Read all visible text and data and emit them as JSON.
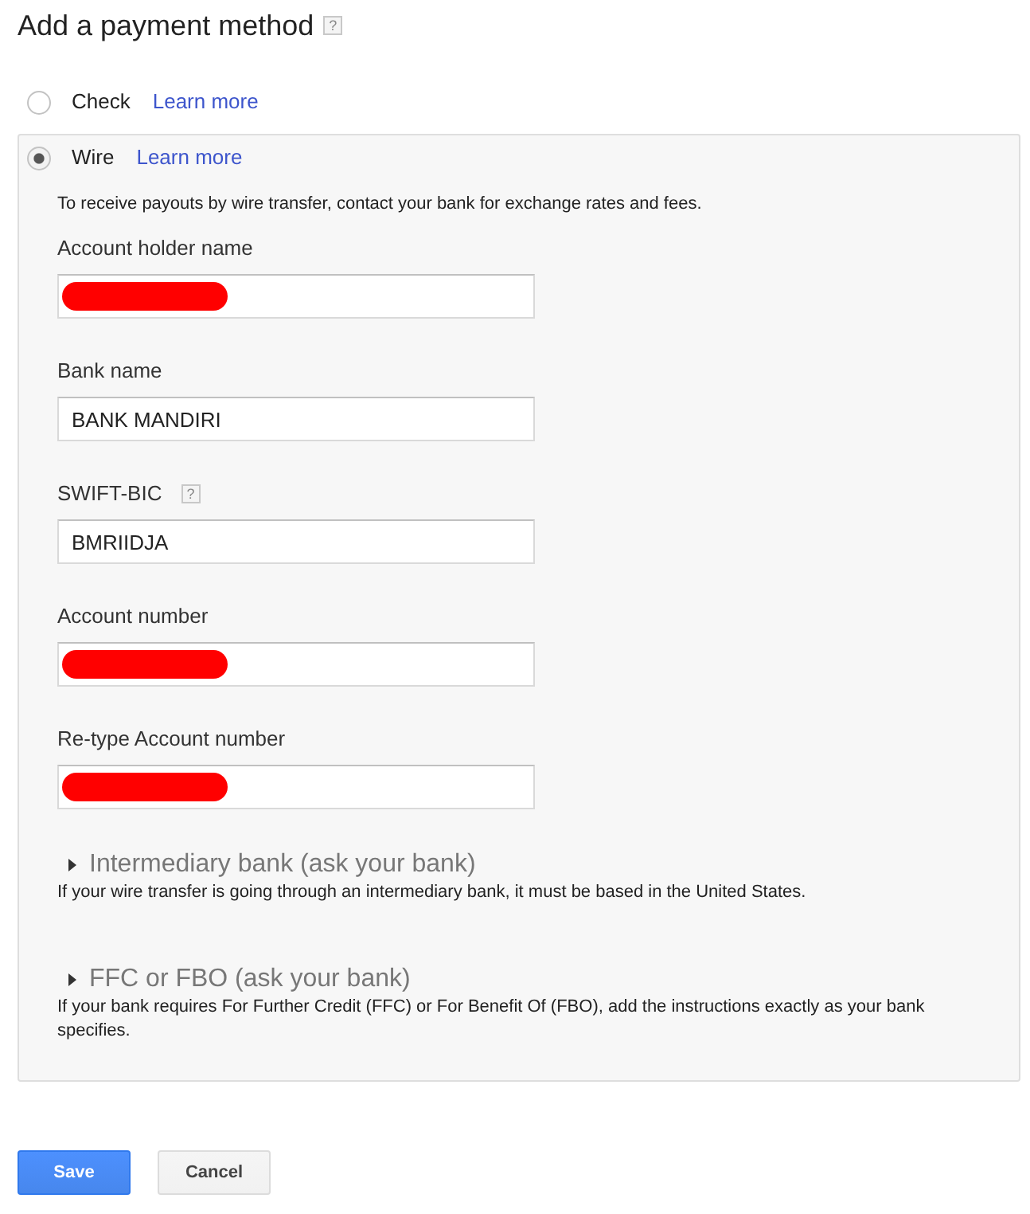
{
  "page": {
    "title": "Add a payment method",
    "help": "?"
  },
  "payment_methods": [
    {
      "label": "Check",
      "link": "Learn more",
      "selected": false
    },
    {
      "label": "Wire",
      "link": "Learn more",
      "selected": true,
      "description": "To receive payouts by wire transfer, contact your bank for exchange rates and fees.",
      "fields": [
        {
          "label": "Account holder name",
          "redacted": true
        },
        {
          "label": "Bank name",
          "value": "BANK MANDIRI",
          "redacted": false
        },
        {
          "label": "SWIFT-BIC",
          "help": "?",
          "value": "BMRIIDJA",
          "redacted": false
        },
        {
          "label": "Account number",
          "redacted": true
        },
        {
          "label": "Re-type Account number",
          "redacted": true
        }
      ],
      "sections": [
        {
          "title": "Intermediary bank (ask your bank)",
          "expanded": false,
          "note": "If your wire transfer is going through an intermediary bank, it must be based in the United States."
        },
        {
          "title": "FFC or FBO (ask your bank)",
          "expanded": false,
          "note": "If your bank requires For Further Credit (FFC) or For Benefit Of (FBO), add the instructions exactly as your bank specifies."
        }
      ]
    }
  ],
  "buttons": [
    {
      "label": "Save",
      "kind": "primary"
    },
    {
      "label": "Cancel",
      "kind": "secondary"
    }
  ]
}
